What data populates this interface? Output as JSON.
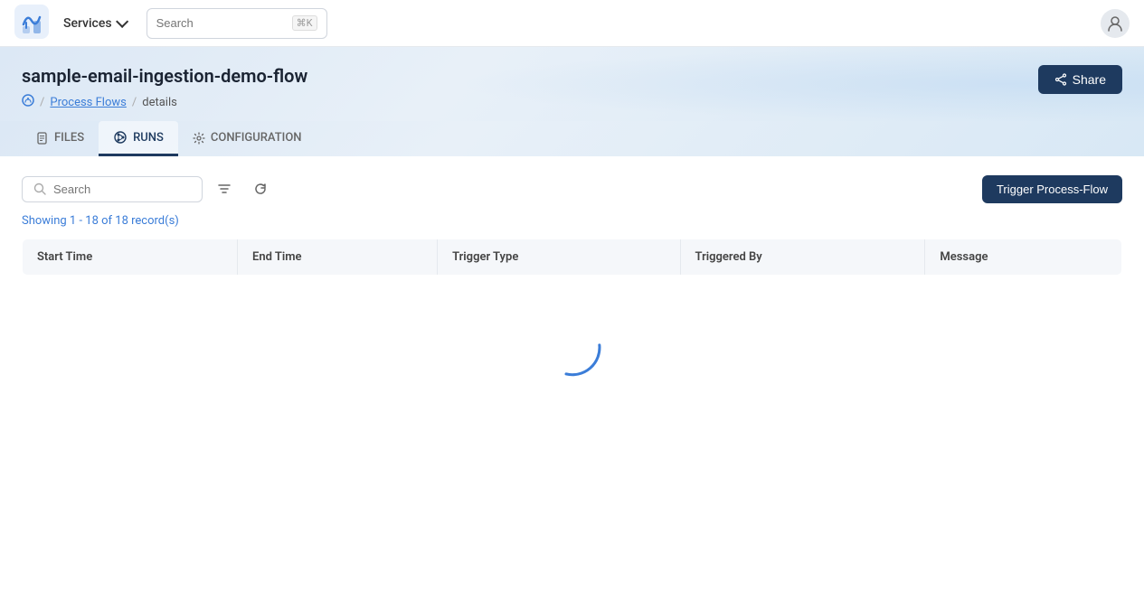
{
  "app": {
    "logo_alt": "App Logo"
  },
  "navbar": {
    "services_label": "Services",
    "search_placeholder": "Search",
    "search_shortcut": "⌘K",
    "user_icon": "person"
  },
  "page": {
    "title": "sample-email-ingestion-demo-flow",
    "breadcrumb": [
      {
        "label": "🌐",
        "type": "icon"
      },
      {
        "label": "Process Flows",
        "type": "link"
      },
      {
        "label": "details",
        "type": "current"
      }
    ],
    "share_button_label": "Share"
  },
  "tabs": [
    {
      "id": "files",
      "label": "FILES",
      "active": false
    },
    {
      "id": "runs",
      "label": "RUNS",
      "active": true
    },
    {
      "id": "configuration",
      "label": "CONFIGURATION",
      "active": false
    }
  ],
  "runs_tab": {
    "search_placeholder": "Search",
    "records_info": "Showing 1 - 18 of 18 record(s)",
    "trigger_button_label": "Trigger Process-Flow",
    "table": {
      "columns": [
        {
          "id": "start_time",
          "label": "Start Time"
        },
        {
          "id": "end_time",
          "label": "End Time"
        },
        {
          "id": "trigger_type",
          "label": "Trigger Type"
        },
        {
          "id": "triggered_by",
          "label": "Triggered By"
        },
        {
          "id": "message",
          "label": "Message"
        }
      ],
      "rows": []
    },
    "loading": true
  }
}
